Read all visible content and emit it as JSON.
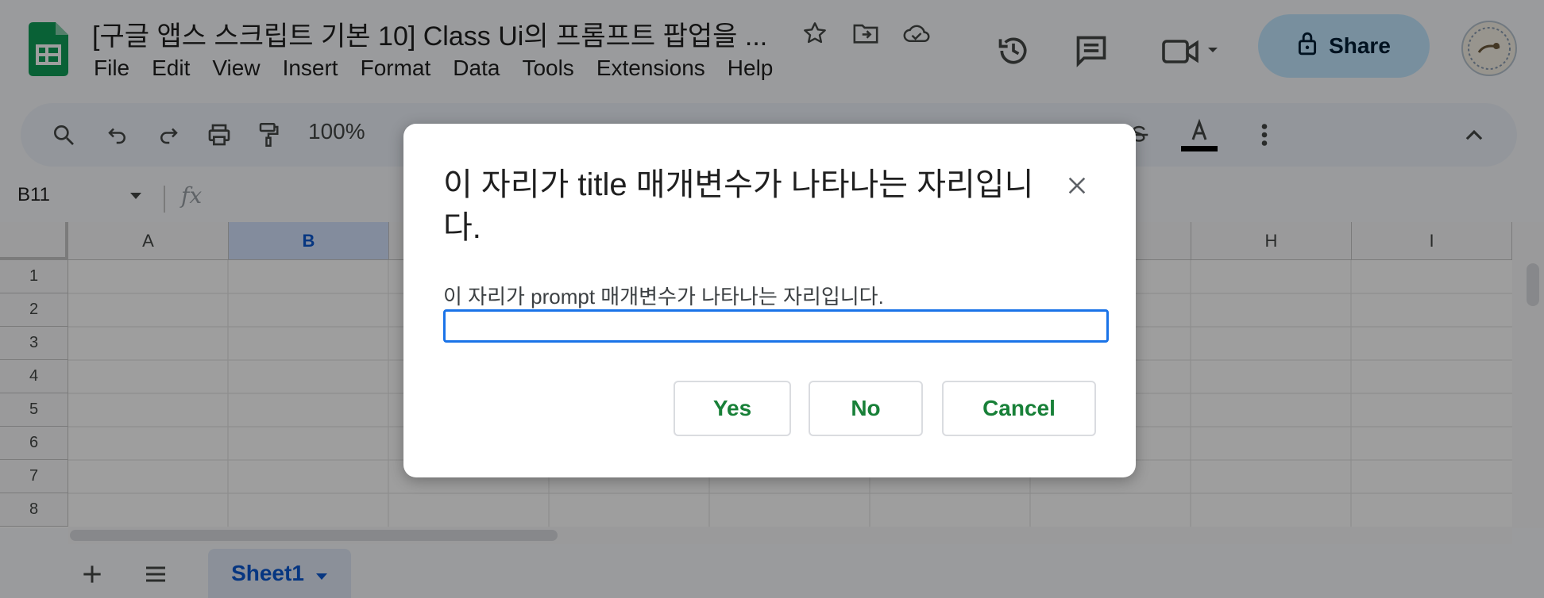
{
  "doc": {
    "title": "[구글 앱스 스크립트 기본 10] Class Ui의 프롬프트 팝업을 ...",
    "menus": [
      "File",
      "Edit",
      "View",
      "Insert",
      "Format",
      "Data",
      "Tools",
      "Extensions",
      "Help"
    ],
    "share_label": "Share"
  },
  "toolbar": {
    "zoom": "100%"
  },
  "formula_bar": {
    "name_box": "B11",
    "fx_label": "fx"
  },
  "grid": {
    "columns": [
      "A",
      "B",
      "",
      "",
      "",
      "",
      "",
      "H",
      "I"
    ],
    "selected_column": "B",
    "rows": [
      "1",
      "2",
      "3",
      "4",
      "5",
      "6",
      "7",
      "8"
    ]
  },
  "sheets": {
    "active": "Sheet1"
  },
  "dialog": {
    "title": "이 자리가 title 매개변수가 나타나는 자리입니다.",
    "prompt": "이 자리가 prompt 매개변수가 나타나는 자리입니다.",
    "input_value": "",
    "buttons": {
      "yes": "Yes",
      "no": "No",
      "cancel": "Cancel"
    }
  },
  "colors": {
    "accent": "#0b57d0",
    "dialog_button_text": "#188038",
    "input_focus": "#1a73e8",
    "share_bg": "#c2e7ff"
  }
}
